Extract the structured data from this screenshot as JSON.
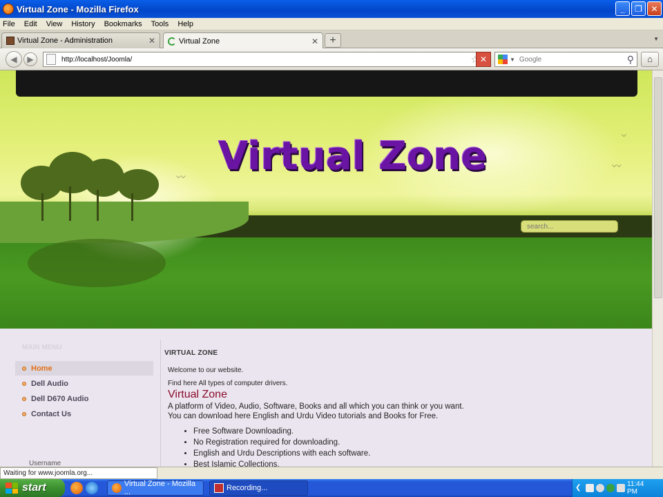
{
  "window": {
    "title": "Virtual Zone - Mozilla Firefox"
  },
  "menubar": [
    "File",
    "Edit",
    "View",
    "History",
    "Bookmarks",
    "Tools",
    "Help"
  ],
  "tabs": [
    {
      "label": "Virtual Zone - Administration"
    },
    {
      "label": "Virtual Zone"
    }
  ],
  "nav": {
    "url": "http://localhost/Joomla/",
    "search_placeholder": "Google"
  },
  "site": {
    "brand": "Virtual Zone",
    "search_placeholder": "search...",
    "menu": [
      "Home",
      "Dell Audio",
      "Dell D670 Audio",
      "Contact Us"
    ],
    "username_label": "Username"
  },
  "article": {
    "heading": "VIRTUAL ZONE",
    "welcome": "Welcome to our website.",
    "find": "Find here All types of computer drivers.",
    "subtitle": "Virtual Zone",
    "p1": "A platform of Video, Audio, Software, Books and all which you can think or you want.",
    "p2": "You can download here English and Urdu Video tutorials and Books for Free.",
    "bullets": [
      "Free Software Downloading.",
      "No Registration required for downloading.",
      "English and Urdu Descriptions with each software.",
      "Best Islamic Collections."
    ]
  },
  "status": {
    "text": "Waiting for www.joomla.org..."
  },
  "taskbar": {
    "start": "start",
    "tasks": [
      "Virtual Zone - Mozilla ...",
      "Recording..."
    ],
    "clock": "11:44 PM"
  }
}
